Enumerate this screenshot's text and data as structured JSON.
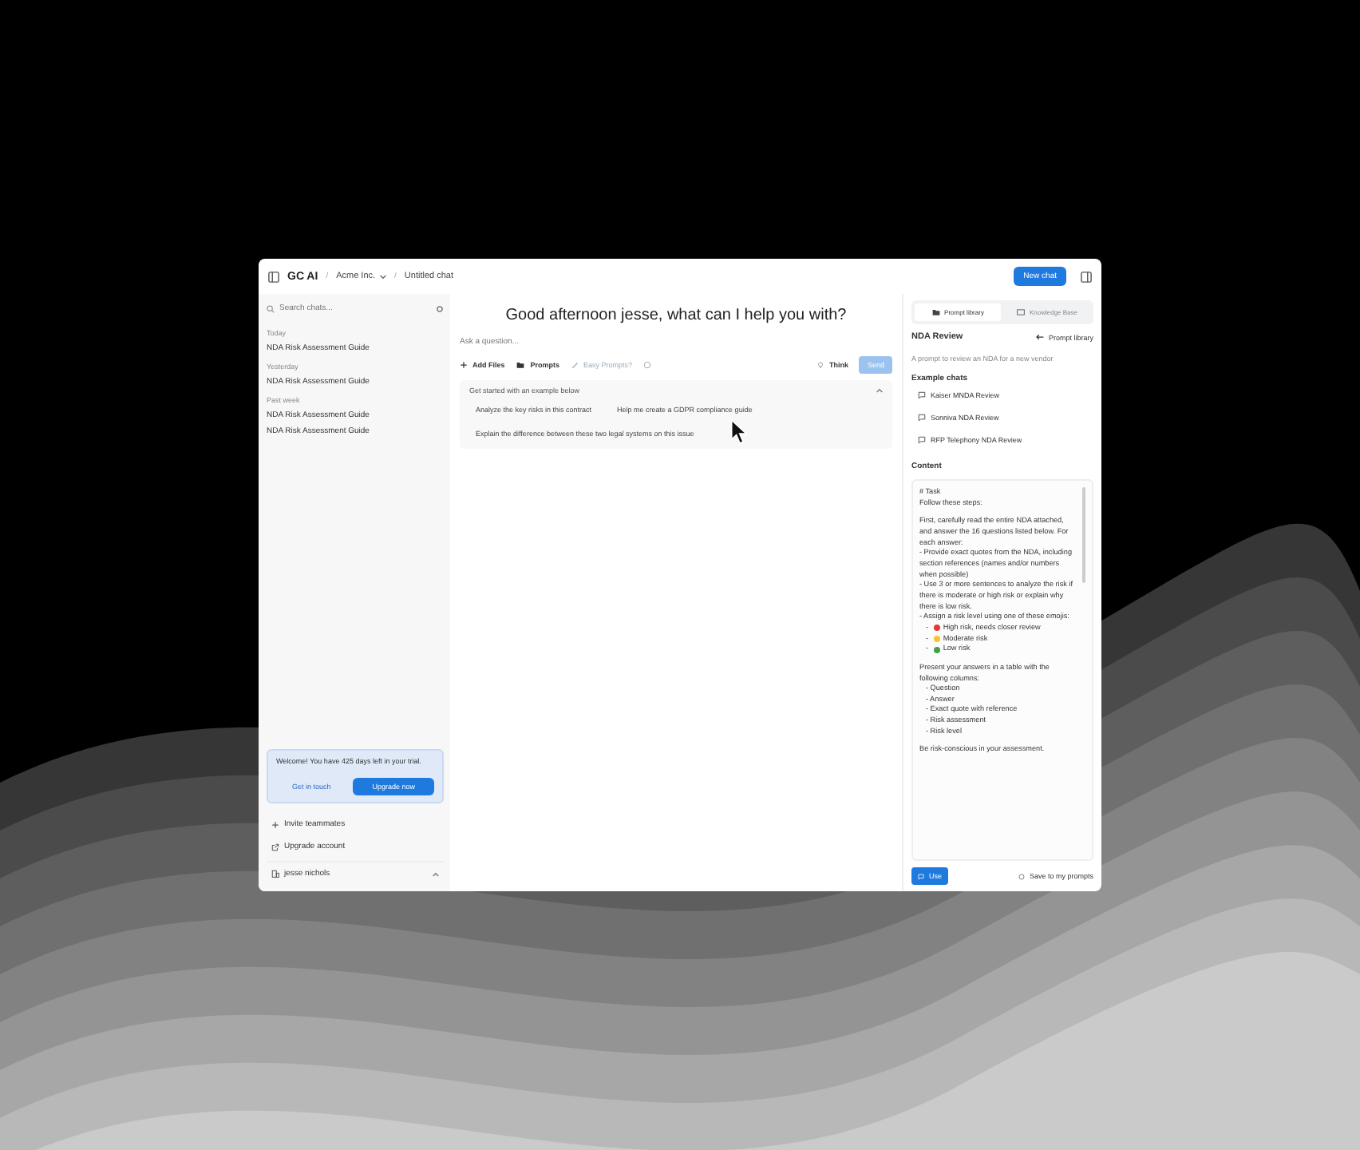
{
  "app": {
    "logo": "GC AI",
    "workspace": "Acme Inc.",
    "chat_title": "Untitled chat",
    "separator": "/",
    "new_chat": "New chat"
  },
  "sidebar": {
    "search": {
      "placeholder": "Search chats..."
    },
    "groups": [
      {
        "label": "Today",
        "items": [
          "NDA Risk Assessment Guide"
        ]
      },
      {
        "label": "Yesterday",
        "items": [
          "NDA Risk Assessment Guide"
        ]
      },
      {
        "label": "Past week",
        "items": [
          "NDA Risk Assessment Guide",
          "NDA Risk Assessment Guide"
        ]
      }
    ],
    "trial": {
      "message": "Welcome! You have 425 days left in your trial.",
      "secondary": "Get in touch",
      "primary": "Upgrade now"
    },
    "links": [
      {
        "kind": "invite",
        "label": "Invite teammates"
      },
      {
        "kind": "upgrade",
        "label": "Upgrade account"
      }
    ],
    "user": "jesse nichols"
  },
  "main": {
    "greeting": "Good afternoon jesse, what can I help you with?",
    "input": {
      "placeholder": "Ask a question..."
    },
    "toolbar": {
      "add_files": "Add Files",
      "prompts": "Prompts",
      "easy_prompts": "Easy Prompts?",
      "think": "Think",
      "send": "Send"
    },
    "examples": {
      "title": "Get started with an example below",
      "expanded": true,
      "chips": [
        "Analyze the key risks in this contract",
        "Help me create a GDPR compliance guide",
        "Explain the difference between these two legal systems on this issue"
      ]
    }
  },
  "right_panel": {
    "tabs": [
      {
        "label": "Prompt library",
        "selected": true
      },
      {
        "label": "Knowledge Base",
        "selected": false
      }
    ],
    "title": "NDA Review",
    "back": "Prompt library",
    "description": "A prompt to review an NDA for a new vendor",
    "example_heading": "Example chats",
    "example_chats": [
      "Kaiser MNDA Review",
      "Sonniva NDA Review",
      "RFP Telephony NDA Review"
    ],
    "content_heading": "Content",
    "content": [
      {
        "lines": [
          "# Task",
          "Follow these steps:"
        ]
      },
      {
        "lines": [
          "First, carefully read the entire NDA attached, and answer the 16 questions listed below. For each answer:",
          "- Provide exact quotes from the NDA, including section references (names and/or numbers when possible)",
          "- Use 3 or more sentences to analyze the risk if there is moderate or high risk or explain why there is low risk.",
          "- Assign a risk level using one of these emojis:"
        ],
        "children": [
          {
            "text": "- ",
            "label": "High risk, needs closer review",
            "color": "#e53935"
          },
          {
            "text": "- ",
            "label": "Moderate risk",
            "color": "#fbc02d"
          },
          {
            "text": "- ",
            "label": "Low risk",
            "color": "#43a047"
          }
        ]
      },
      {
        "lines": [
          "Present your answers in a table with the following columns:"
        ],
        "children": [
          {
            "text": "- Question"
          },
          {
            "text": "- Answer"
          },
          {
            "text": "- Exact quote with reference"
          },
          {
            "text": "- Risk assessment"
          },
          {
            "text": "- Risk level"
          }
        ]
      },
      {
        "lines": [
          "Be risk-conscious in your assessment."
        ]
      }
    ],
    "use": "Use",
    "save": "Save to my prompts"
  }
}
